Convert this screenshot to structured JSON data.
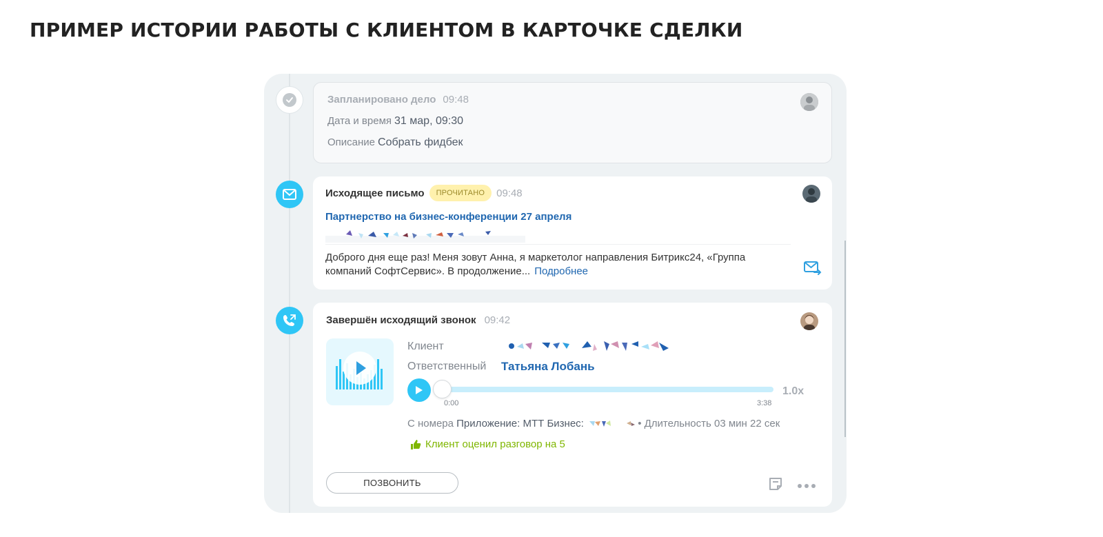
{
  "page": {
    "title": "ПРИМЕР ИСТОРИИ РАБОТЫ С КЛИЕНТОМ В КАРТОЧКЕ СДЕЛКИ"
  },
  "planned": {
    "title": "Запланировано дело",
    "time": "09:48",
    "datetime_label": "Дата и время",
    "datetime_value": "31 мар, 09:30",
    "description_label": "Описание",
    "description_value": "Собрать фидбек"
  },
  "email": {
    "title": "Исходящее письмо",
    "badge": "ПРОЧИТАНО",
    "time": "09:48",
    "subject": "Партнерство на бизнес-конференции 27 апреля",
    "body": "Доброго дня еще раз! Меня зовут Анна, я маркетолог направления Битрикс24, «Группа компаний СофтСервис». В продолжение...",
    "more_link": "Подробнее"
  },
  "call": {
    "title": "Завершён исходящий звонок",
    "time": "09:42",
    "client_label": "Клиент",
    "responsible_label": "Ответственный",
    "responsible_name": "Татьяна Лобань",
    "player": {
      "start": "0:00",
      "end": "3:38",
      "speed": "1.0x",
      "progress": 0.0
    },
    "from_label": "С номера",
    "from_value": "Приложение: МТТ Бизнес:",
    "duration_label": "• Длительность",
    "duration_value": "03 мин 22 сек",
    "rating": "Клиент оценил разговор на 5",
    "call_button": "ПОЗВОНИТЬ"
  },
  "colors": {
    "accent": "#2fc6f6",
    "link": "#2067b0",
    "badge_bg": "#fff1ad",
    "rating_green": "#7fb600",
    "timeline_bg": "#eef2f4"
  },
  "icons": [
    "check-icon",
    "mail-icon",
    "phone-icon",
    "play-icon",
    "sound-wave-icon",
    "thumbs-up-icon",
    "mail-forward-icon",
    "note-icon",
    "more-icon"
  ]
}
